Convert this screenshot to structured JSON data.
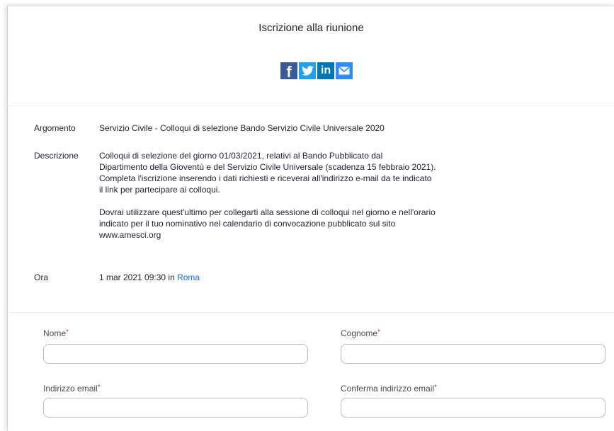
{
  "page": {
    "title": "Iscrizione alla riunione"
  },
  "share": {
    "icons": [
      "facebook-icon",
      "twitter-icon",
      "linkedin-icon",
      "email-icon"
    ],
    "colors": {
      "facebook": "#3b5998",
      "twitter": "#1da1f2",
      "linkedin": "#0077b5",
      "email": "#2d8cff"
    }
  },
  "details": {
    "topic_label": "Argomento",
    "topic_value": "Servizio Civile - Colloqui di selezione Bando Servizio Civile Universale 2020",
    "description_label": "Descrizione",
    "description_lines_p1": [
      "Colloqui di selezione del giorno 01/03/2021, relativi al Bando Pubblicato dal",
      "Dipartimento della Gioventù e del Servizio Civile Universale (scadenza 15 febbraio 2021).",
      "Completa l'iscrizione inserendo i dati richiesti e riceverai all'indirizzo e-mail da te indicato",
      "il link per partecipare ai colloqui."
    ],
    "description_lines_p2": [
      "Dovrai utilizzare quest'ultimo per collegarti alla sessione di colloqui nel giorno e nell'orario",
      "indicato per il tuo nominativo nel calendario di convocazione pubblicato sul sito",
      "www.amesci.org"
    ],
    "time_label": "Ora",
    "time_value": "1 mar 2021 09:30 in ",
    "timezone_link": "Roma"
  },
  "form": {
    "required_mark": "*",
    "first_name_label": "Nome",
    "last_name_label": "Cognome",
    "email_label": "Indirizzo email",
    "confirm_email_label": "Conferma indirizzo email",
    "first_name_value": "",
    "last_name_value": "",
    "email_value": "",
    "confirm_email_value": ""
  },
  "colors": {
    "link": "#0e71eb",
    "required": "#e02828",
    "input_border": "#babacc"
  }
}
